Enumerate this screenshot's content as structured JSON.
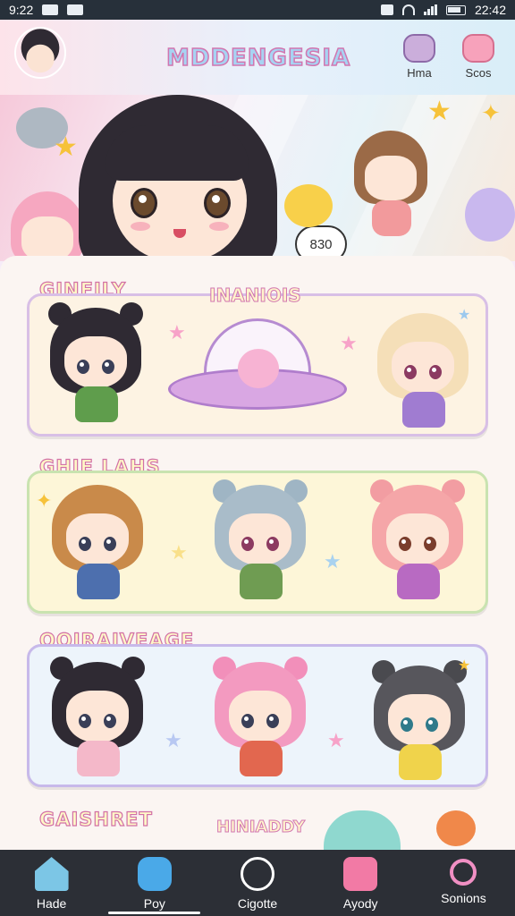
{
  "status_bar": {
    "time_left": "9:22",
    "time_right": "22:42"
  },
  "header": {
    "title": "MDDENGESIA",
    "actions": [
      {
        "label": "Hma"
      },
      {
        "label": "Scos"
      }
    ]
  },
  "hero": {
    "speech": "830"
  },
  "sections": [
    {
      "heading": "GINFILY",
      "sub_label": "INANIOIS"
    },
    {
      "heading": "GHIE LAHS"
    },
    {
      "heading": "OOIRAIVEAGE"
    },
    {
      "heading": "GAISHRET",
      "sub_label": "HINIADDY"
    }
  ],
  "bottom_nav": [
    {
      "label": "Hade",
      "icon": "house-icon"
    },
    {
      "label": "Poy",
      "icon": "game-controller-icon"
    },
    {
      "label": "Cigotte",
      "icon": "circle-icon"
    },
    {
      "label": "Ayody",
      "icon": "activity-icon"
    },
    {
      "label": "Sonions",
      "icon": "settings-icon"
    }
  ],
  "colors": {
    "nav_background": "#2c2f36",
    "title_stroke": "#d276b0",
    "heading_fill": "#fff8c7"
  }
}
